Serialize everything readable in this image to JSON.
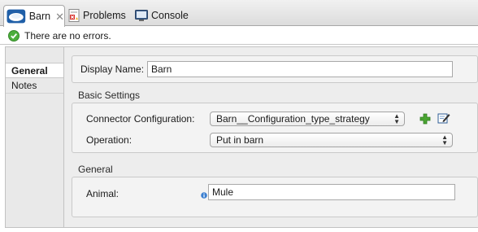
{
  "tabs": {
    "barn": "Barn",
    "problems": "Problems",
    "console": "Console"
  },
  "status": {
    "message": "There are no errors."
  },
  "sidebar": {
    "items": [
      {
        "label": "General"
      },
      {
        "label": "Notes"
      }
    ]
  },
  "form": {
    "display_name_label": "Display Name:",
    "display_name_value": "Barn",
    "basic_settings_title": "Basic Settings",
    "connector_config_label": "Connector Configuration:",
    "connector_config_value": "Barn__Configuration_type_strategy",
    "operation_label": "Operation:",
    "operation_value": "Put in barn",
    "general_title": "General",
    "animal_label": "Animal:",
    "animal_value": "Mule"
  },
  "icons": {
    "barn_tab": "barn-cloud-icon",
    "problems_tab": "problems-icon",
    "console_tab": "console-icon",
    "status": "check-circle-icon",
    "add": "plus-icon",
    "edit": "edit-icon",
    "info": "info-icon"
  },
  "colors": {
    "check": "#4cae3c",
    "plus": "#4aa532",
    "logo": "#2a7bd0"
  }
}
